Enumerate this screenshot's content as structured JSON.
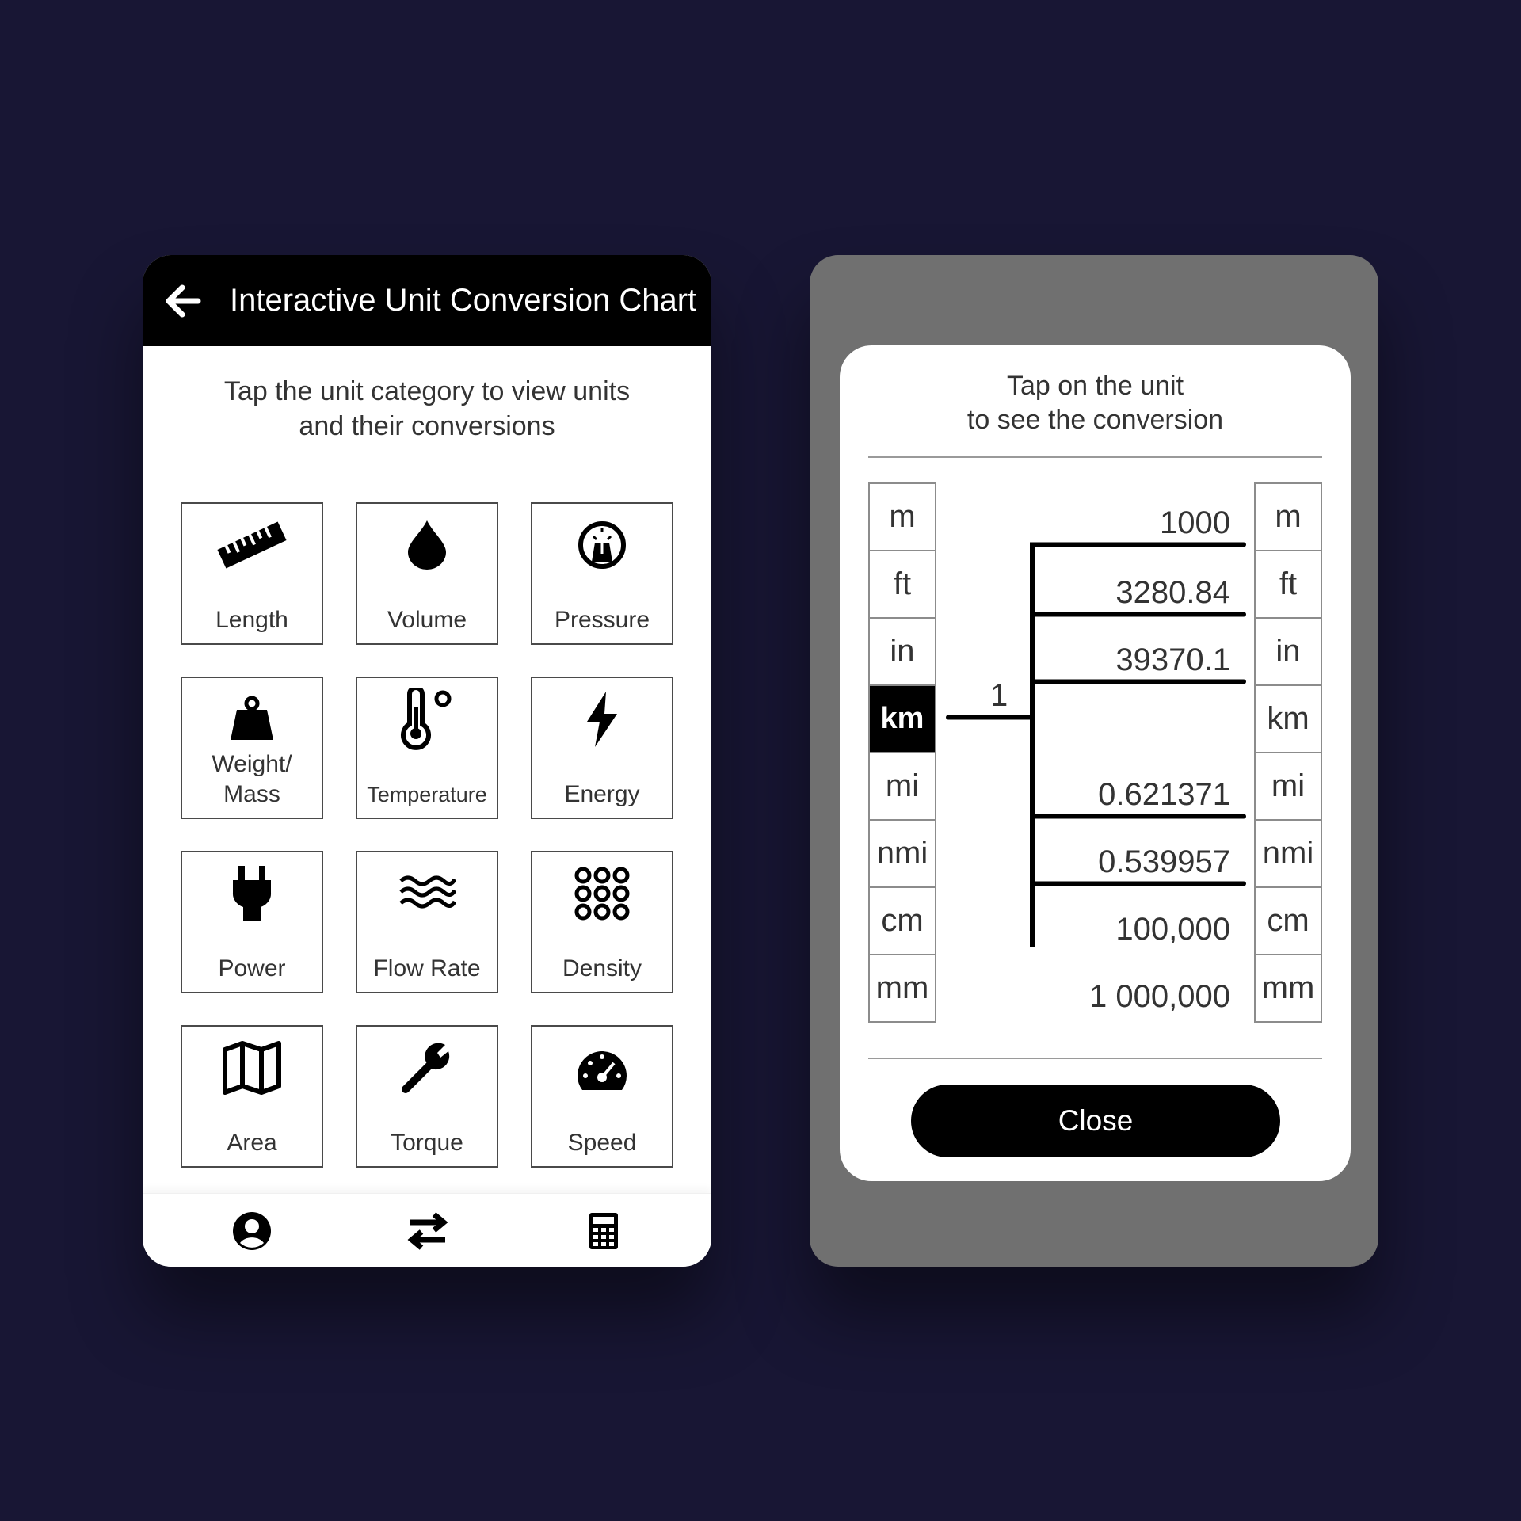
{
  "app": {
    "title": "Interactive Unit Conversion Chart",
    "instruction_line1": "Tap the unit category to view units",
    "instruction_line2": "and their conversions"
  },
  "categories": [
    {
      "label": "Length",
      "icon": "ruler-icon"
    },
    {
      "label": "Volume",
      "icon": "drop-icon"
    },
    {
      "label": "Pressure",
      "icon": "gauge-icon"
    },
    {
      "label_line1": "Weight/",
      "label_line2": "Mass",
      "icon": "weight-icon"
    },
    {
      "label": "Temperature",
      "icon": "thermometer-icon"
    },
    {
      "label": "Energy",
      "icon": "lightning-icon"
    },
    {
      "label": "Power",
      "icon": "plug-icon"
    },
    {
      "label": "Flow Rate",
      "icon": "waves-icon"
    },
    {
      "label": "Density",
      "icon": "dots-grid-icon"
    },
    {
      "label": "Area",
      "icon": "map-icon"
    },
    {
      "label": "Torque",
      "icon": "wrench-icon"
    },
    {
      "label": "Speed",
      "icon": "speedometer-icon"
    }
  ],
  "bottom_nav": [
    {
      "icon": "account-icon"
    },
    {
      "icon": "swap-icon"
    },
    {
      "icon": "calculator-icon"
    }
  ],
  "modal": {
    "instruction_line1": "Tap on the unit",
    "instruction_line2": "to see the conversion",
    "units_left": [
      "m",
      "ft",
      "in",
      "km",
      "mi",
      "nmi",
      "cm",
      "mm"
    ],
    "units_right": [
      "m",
      "ft",
      "in",
      "km",
      "mi",
      "nmi",
      "cm",
      "mm"
    ],
    "selected_unit": "km",
    "source_value": "1",
    "conversions": {
      "m": "1000",
      "ft": "3280.84",
      "in": "39370.1",
      "mi": "0.621371",
      "nmi": "0.539957",
      "cm": "100,000",
      "mm": "1 000,000"
    },
    "close_label": "Close"
  },
  "colors": {
    "background": "#181634",
    "header": "#000000",
    "overlay": "#707070",
    "selected_cell": "#000000"
  }
}
